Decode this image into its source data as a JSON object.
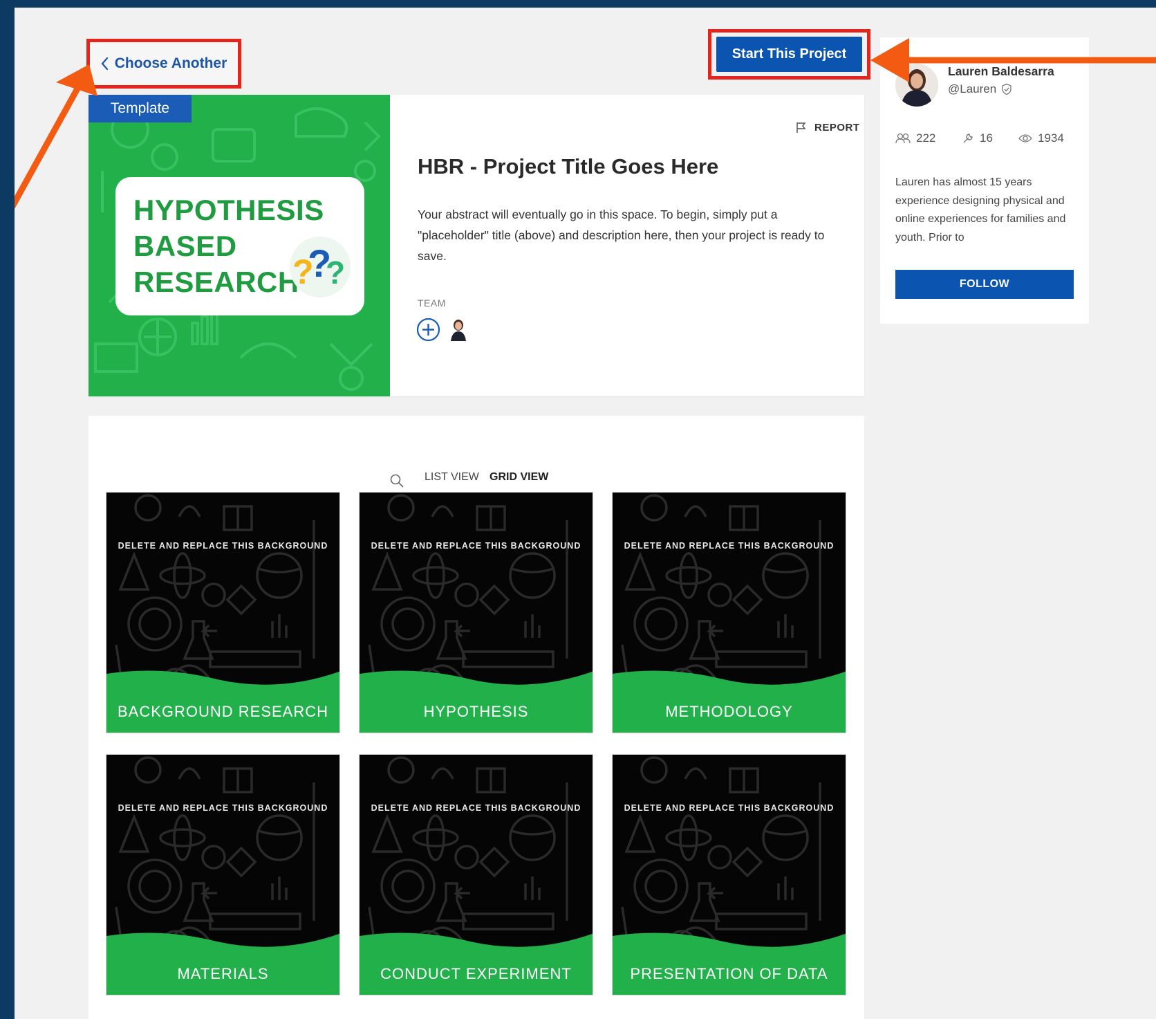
{
  "nav": {
    "back_label": "Choose Another",
    "start_label": "Start This Project"
  },
  "hero": {
    "badge": "Template",
    "image_lines": [
      "HYPOTHESIS",
      "BASED",
      "RESEARCH"
    ],
    "report_label": "REPORT",
    "title": "HBR - Project Title Goes Here",
    "abstract": "Your abstract will eventually go in this space. To begin, simply put a \"placeholder\" title (above) and description here, then your project is ready to save.",
    "team_label": "TEAM"
  },
  "author": {
    "name": "Lauren Baldesarra",
    "handle": "@Lauren",
    "stats": {
      "followers": "222",
      "projects": "16",
      "views": "1934"
    },
    "bio": "Lauren has almost 15 years experience designing physical and online experiences for families and youth. Prior to",
    "follow_label": "FOLLOW"
  },
  "view_tabs": {
    "list": "LIST VIEW",
    "grid": "GRID VIEW",
    "active": "GRID VIEW"
  },
  "tiles": [
    {
      "note": "DELETE AND REPLACE THIS BACKGROUND",
      "label": "BACKGROUND RESEARCH"
    },
    {
      "note": "DELETE AND REPLACE THIS BACKGROUND",
      "label": "HYPOTHESIS"
    },
    {
      "note": "DELETE AND REPLACE THIS BACKGROUND",
      "label": "METHODOLOGY"
    },
    {
      "note": "DELETE AND REPLACE THIS BACKGROUND",
      "label": "MATERIALS"
    },
    {
      "note": "DELETE AND REPLACE THIS BACKGROUND",
      "label": "CONDUCT EXPERIMENT"
    },
    {
      "note": "DELETE AND REPLACE THIS BACKGROUND",
      "label": "PRESENTATION OF DATA"
    }
  ],
  "colors": {
    "frame": "#0d3a63",
    "brand_blue": "#0b55b0",
    "highlight_red": "#e5251b",
    "arrow_orange": "#f45b12",
    "tile_green": "#22b04b"
  },
  "icons": [
    "chevron-left-icon",
    "flag-icon",
    "plus-circle-icon",
    "verified-icon",
    "users-icon",
    "wrench-icon",
    "eye-icon",
    "search-icon"
  ]
}
